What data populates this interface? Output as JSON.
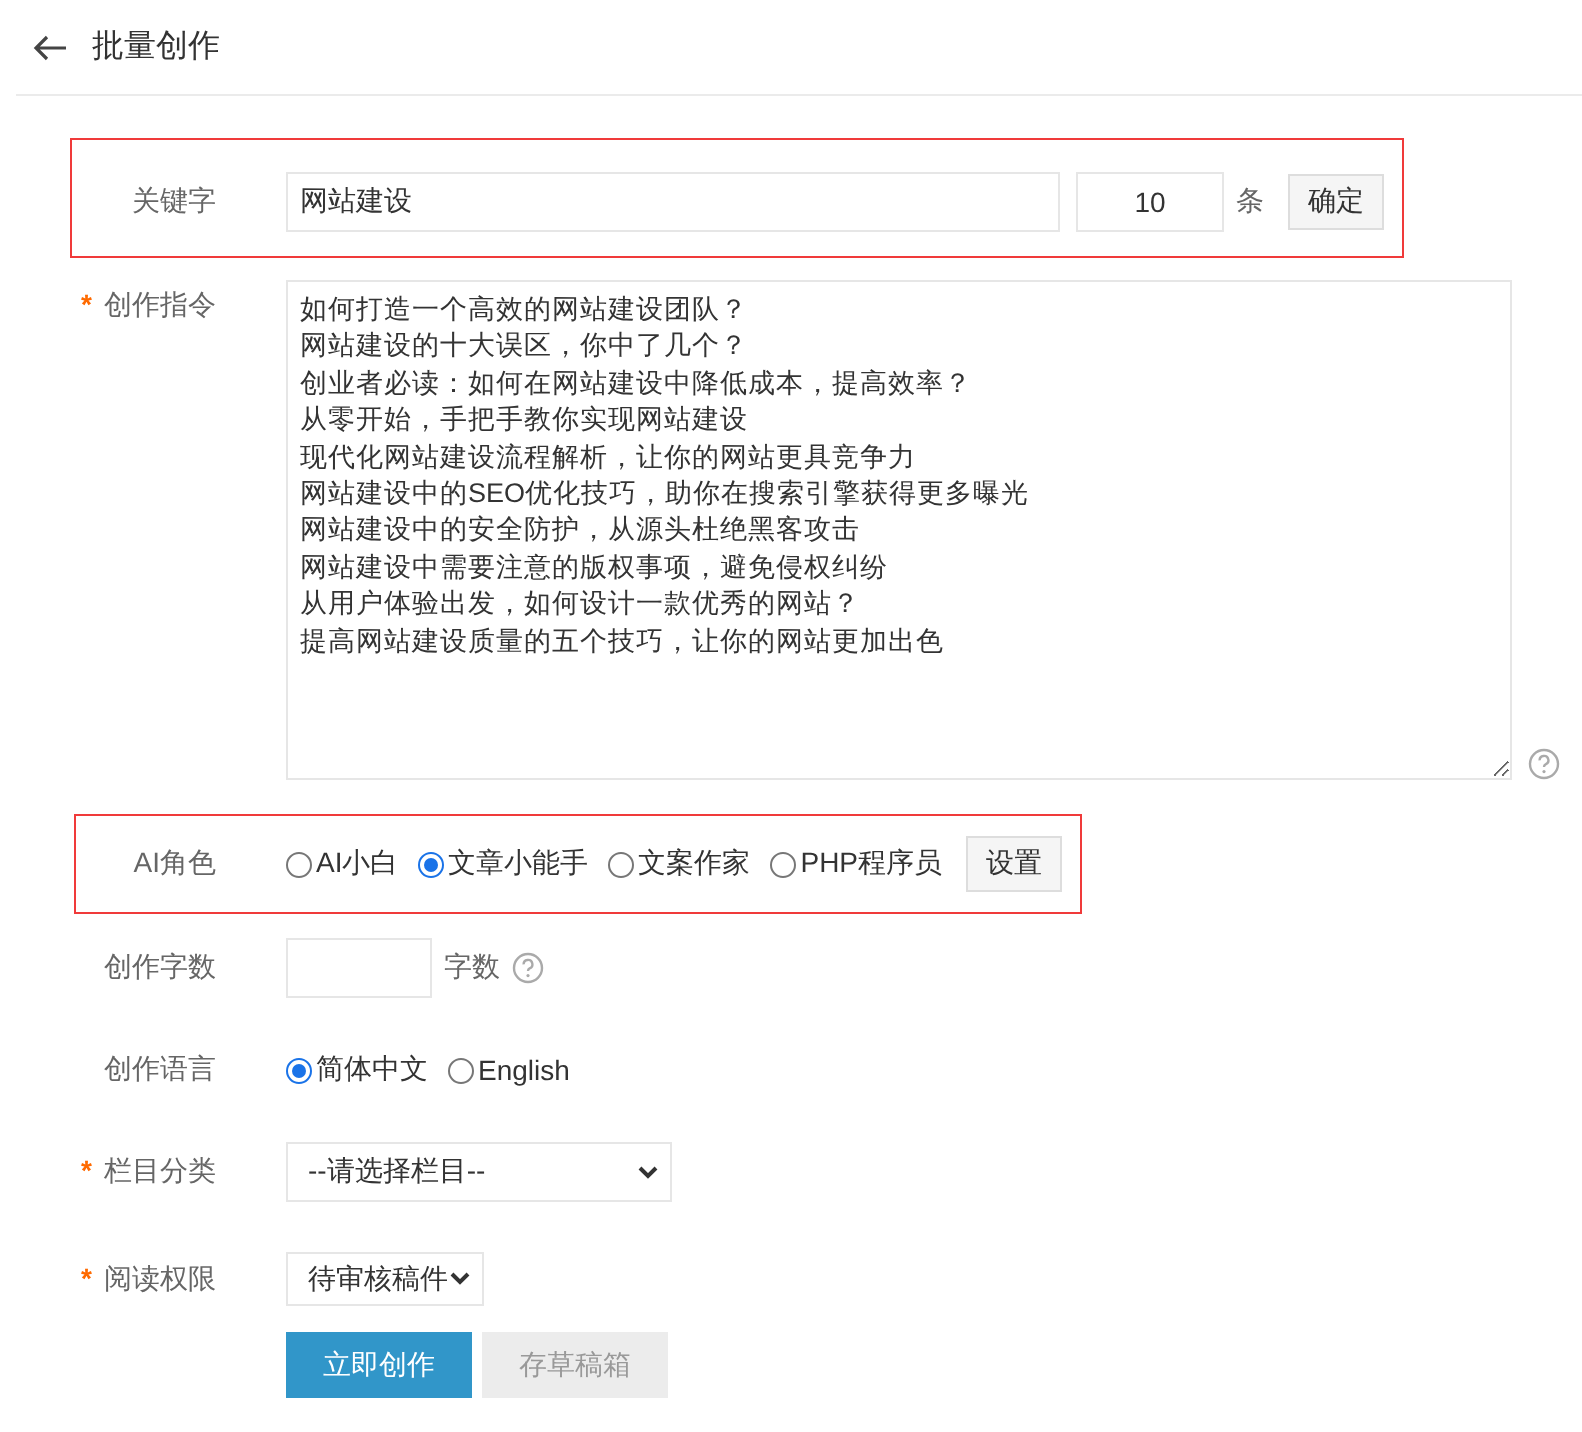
{
  "header": {
    "title": "批量创作"
  },
  "keyword": {
    "label": "关键字",
    "highlighted": true,
    "value": "网站建设",
    "count": "10",
    "unit": "条",
    "button": "确定"
  },
  "instructions": {
    "marker": "*",
    "label": "创作指令",
    "lines": [
      "如何打造一个高效的网站建设团队？",
      "网站建设的十大误区，你中了几个？",
      "创业者必读：如何在网站建设中降低成本，提高效率？",
      "从零开始，手把手教你实现网站建设",
      "现代化网站建设流程解析，让你的网站更具竞争力",
      "网站建设中的SEO优化技巧，助你在搜索引擎获得更多曝光",
      "网站建设中的安全防护，从源头杜绝黑客攻击",
      "网站建设中需要注意的版权事项，避免侵权纠纷",
      "从用户体验出发，如何设计一款优秀的网站？",
      "提高网站建设质量的五个技巧，让你的网站更加出色"
    ]
  },
  "ai_role": {
    "label": "AI角色",
    "highlighted": true,
    "button": "设置",
    "options": [
      {
        "label": "AI小白",
        "selected": false
      },
      {
        "label": "文章小能手",
        "selected": true
      },
      {
        "label": "文案作家",
        "selected": false
      },
      {
        "label": "PHP程序员",
        "selected": false
      }
    ]
  },
  "word_count": {
    "label": "创作字数",
    "unit": "字数"
  },
  "language": {
    "label": "创作语言",
    "options": [
      {
        "label": "简体中文",
        "selected": true
      },
      {
        "label": "English",
        "selected": false
      }
    ]
  },
  "category": {
    "marker": "*",
    "label": "栏目分类",
    "value": "--请选择栏目--"
  },
  "permission": {
    "marker": "*",
    "label": "阅读权限",
    "value": "待审核稿件"
  },
  "buttons": [
    {
      "label": "立即创作",
      "kind": "primary"
    },
    {
      "label": "存草稿箱",
      "kind": "secondary"
    }
  ]
}
